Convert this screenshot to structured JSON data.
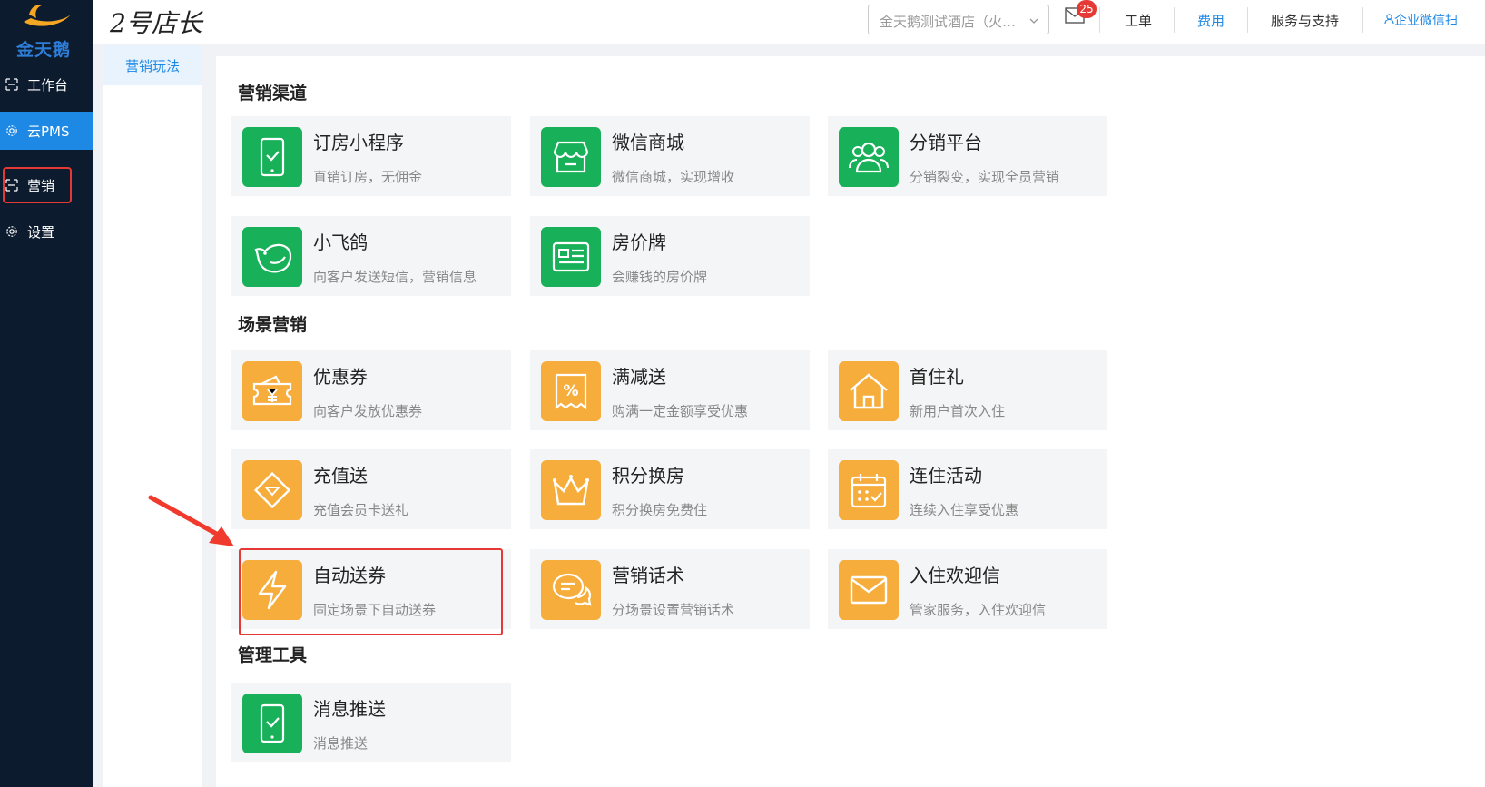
{
  "sidebar": {
    "logo_text": "金天鹅",
    "items": [
      {
        "label": "工作台",
        "icon": "workbench-icon"
      },
      {
        "label": "云PMS",
        "icon": "gear-icon"
      },
      {
        "label": "营销",
        "icon": "marketing-icon"
      },
      {
        "label": "设置",
        "icon": "gear-icon"
      }
    ]
  },
  "header": {
    "brand": "2号店长",
    "store_select": "金天鹅测试酒店（火…",
    "mail_badge": "25",
    "links": {
      "ticket": "工单",
      "fees": "费用",
      "service": "服务与支持",
      "wecom": "企业微信扫"
    }
  },
  "subnav": {
    "active_tab": "营销玩法"
  },
  "sections": [
    {
      "title": "营销渠道",
      "cards": [
        {
          "title": "订房小程序",
          "desc": "直销订房，无佣金",
          "icon": "phone-check-icon",
          "color": "#18b15a"
        },
        {
          "title": "微信商城",
          "desc": "微信商城，实现增收",
          "icon": "store-icon",
          "color": "#18b15a"
        },
        {
          "title": "分销平台",
          "desc": "分销裂变，实现全员营销",
          "icon": "users-icon",
          "color": "#18b15a"
        },
        {
          "title": "小飞鸽",
          "desc": "向客户发送短信，营销信息",
          "icon": "bird-icon",
          "color": "#18b15a"
        },
        {
          "title": "房价牌",
          "desc": "会赚钱的房价牌",
          "icon": "price-board-icon",
          "color": "#18b15a"
        }
      ]
    },
    {
      "title": "场景营销",
      "cards": [
        {
          "title": "优惠券",
          "desc": "向客户发放优惠券",
          "icon": "coupon-icon",
          "color": "#f6ad3c"
        },
        {
          "title": "满减送",
          "desc": "购满一定金额享受优惠",
          "icon": "percent-icon",
          "color": "#f6ad3c"
        },
        {
          "title": "首住礼",
          "desc": "新用户首次入住",
          "icon": "home-icon",
          "color": "#f6ad3c"
        },
        {
          "title": "充值送",
          "desc": "充值会员卡送礼",
          "icon": "diamond-icon",
          "color": "#f6ad3c"
        },
        {
          "title": "积分换房",
          "desc": "积分换房免费住",
          "icon": "crown-icon",
          "color": "#f6ad3c"
        },
        {
          "title": "连住活动",
          "desc": "连续入住享受优惠",
          "icon": "calendar-check-icon",
          "color": "#f6ad3c"
        },
        {
          "title": "自动送券",
          "desc": "固定场景下自动送券",
          "icon": "lightning-icon",
          "color": "#f6ad3c"
        },
        {
          "title": "营销话术",
          "desc": "分场景设置营销话术",
          "icon": "chat-icon",
          "color": "#f6ad3c"
        },
        {
          "title": "入住欢迎信",
          "desc": "管家服务，入住欢迎信",
          "icon": "mail-icon",
          "color": "#f6ad3c"
        }
      ]
    },
    {
      "title": "管理工具",
      "cards": [
        {
          "title": "消息推送",
          "desc": "消息推送",
          "icon": "phone-check-icon",
          "color": "#18b15a"
        }
      ]
    }
  ]
}
